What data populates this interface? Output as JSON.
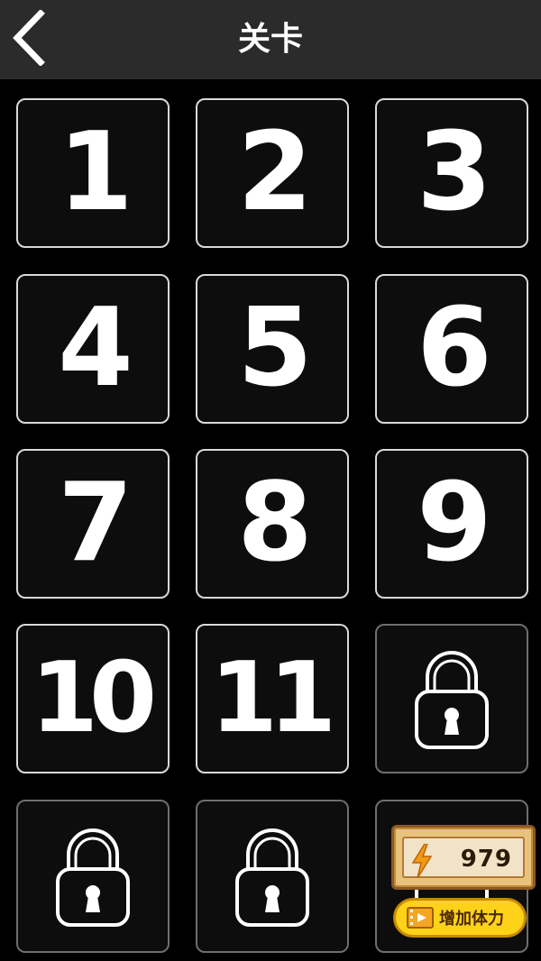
{
  "header": {
    "title": "关卡",
    "back_icon": "chevron-left-icon"
  },
  "levels": [
    {
      "label": "1",
      "locked": false
    },
    {
      "label": "2",
      "locked": false
    },
    {
      "label": "3",
      "locked": false
    },
    {
      "label": "4",
      "locked": false
    },
    {
      "label": "5",
      "locked": false
    },
    {
      "label": "6",
      "locked": false
    },
    {
      "label": "7",
      "locked": false
    },
    {
      "label": "8",
      "locked": false
    },
    {
      "label": "9",
      "locked": false
    },
    {
      "label": "10",
      "locked": false
    },
    {
      "label": "11",
      "locked": false
    },
    {
      "label": "",
      "locked": true
    },
    {
      "label": "",
      "locked": true
    },
    {
      "label": "",
      "locked": true
    },
    {
      "label": "",
      "locked": true
    }
  ],
  "stamina": {
    "value": "979",
    "icon": "lightning-icon",
    "add_label": "增加体力",
    "add_icon": "video-icon"
  },
  "colors": {
    "background": "#000000",
    "header": "#2b2b2b",
    "tile": "#0d0d0d",
    "tile_border": "#d9d9d9",
    "stamina_panel": "#e8c37d",
    "add_button": "#ffd21a"
  }
}
